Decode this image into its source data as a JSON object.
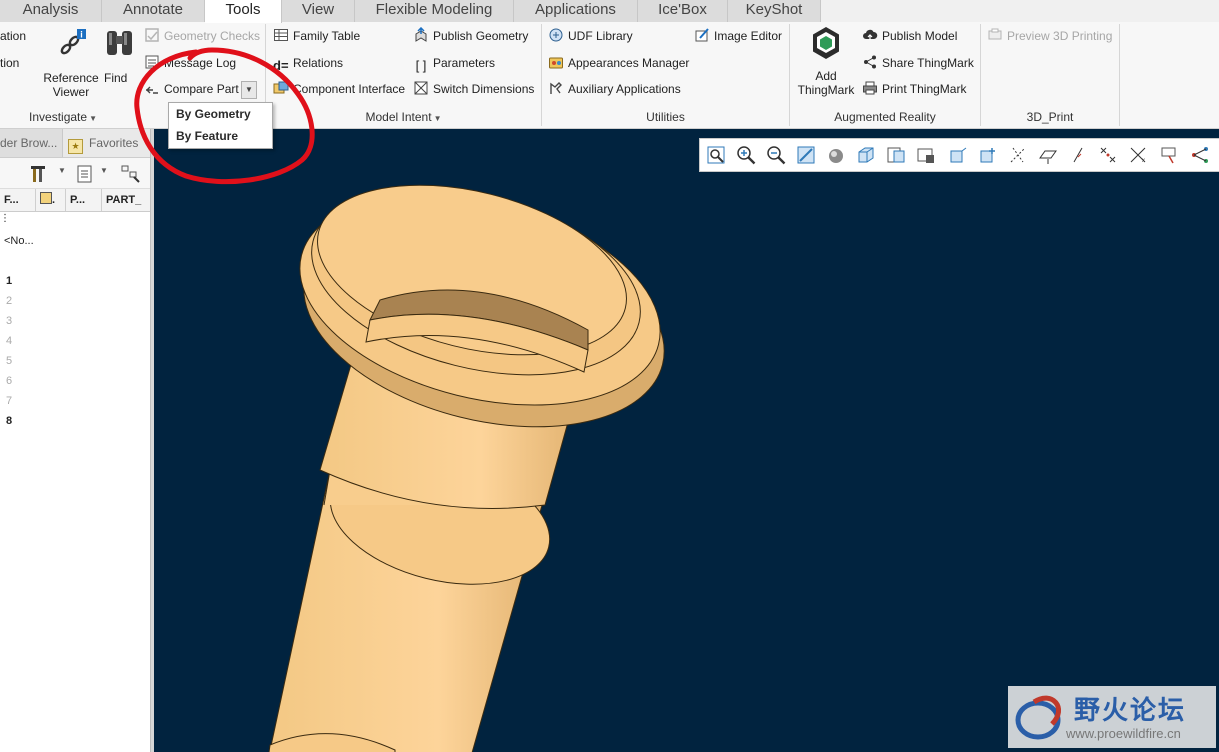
{
  "tabs": [
    "Analysis",
    "Annotate",
    "Tools",
    "View",
    "Flexible Modeling",
    "Applications",
    "Ice'Box",
    "KeyShot"
  ],
  "active_tab": "Tools",
  "ribbon": {
    "investigate": {
      "label": "Investigate",
      "clipped_top": "ation",
      "clipped_mid": "tion",
      "reference_viewer": [
        "Reference",
        "Viewer"
      ],
      "find": "Find",
      "geometry_checks": "Geometry Checks",
      "message_log": "Message Log",
      "compare_part": "Compare Part"
    },
    "model_intent": {
      "label": "Model Intent",
      "family_table": "Family Table",
      "relations": "Relations",
      "component_interface": "Component Interface",
      "publish_geometry": "Publish Geometry",
      "parameters": "Parameters",
      "switch_dimensions": "Switch Dimensions"
    },
    "utilities": {
      "label": "Utilities",
      "udf_library": "UDF Library",
      "appearances_manager": "Appearances Manager",
      "auxiliary_applications": "Auxiliary Applications",
      "image_editor": "Image Editor"
    },
    "augmented_reality": {
      "label": "Augmented Reality",
      "add_thingmark": [
        "Add",
        "ThingMark"
      ],
      "publish_model": "Publish Model",
      "share_thingmark": "Share ThingMark",
      "print_thingmark": "Print ThingMark"
    },
    "print3d": {
      "label": "3D_Print",
      "preview": "Preview 3D Printing"
    }
  },
  "dropdown": {
    "items": [
      "By Geometry",
      "By Feature"
    ]
  },
  "left_panel": {
    "tabs": [
      "der Brow...",
      "Favorites"
    ],
    "columns": [
      "F...",
      "",
      "P...",
      "PART_"
    ],
    "row_text": "<No...",
    "row_numbers": [
      "1",
      "2",
      "3",
      "4",
      "5",
      "6",
      "7",
      "8"
    ]
  },
  "colors": {
    "graphics_bg": "#01233f",
    "part": "#f6c987",
    "annotation": "#e0101a"
  },
  "watermark": {
    "title": "野火论坛",
    "url": "www.proewildfire.cn"
  }
}
